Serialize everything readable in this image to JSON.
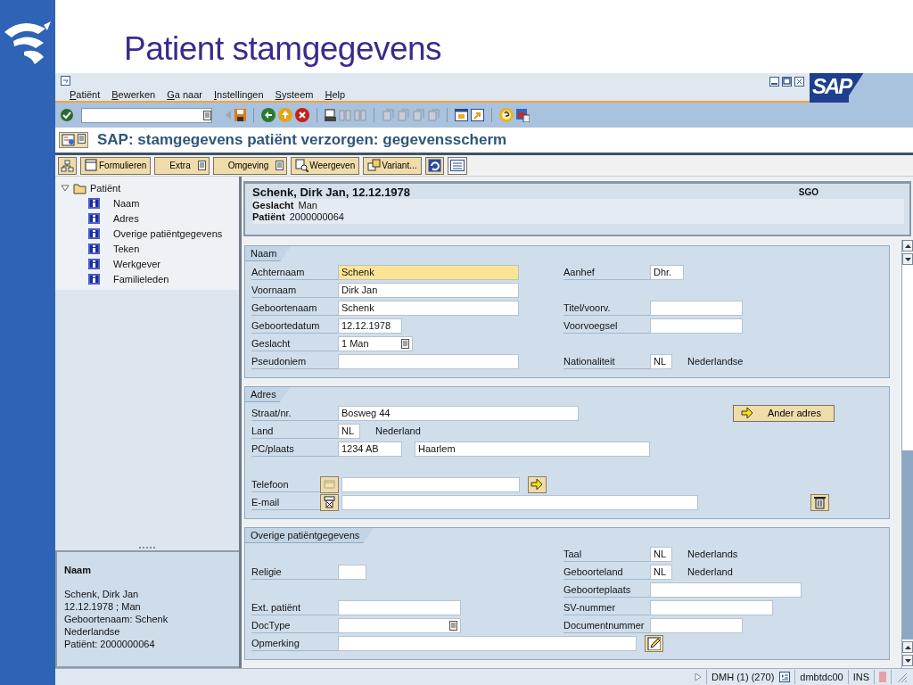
{
  "slide": {
    "title": "Patient stamgegevens"
  },
  "window": {
    "logo": "SAP"
  },
  "menu": [
    {
      "label": "Patiënt"
    },
    {
      "label": "Bewerken"
    },
    {
      "label": "Ga naar"
    },
    {
      "label": "Instellingen"
    },
    {
      "label": "Systeem"
    },
    {
      "label": "Help"
    }
  ],
  "screen_title": "SAP: stamgegevens patiënt verzorgen: gegevensscherm",
  "app_toolbar": [
    {
      "label": "Formulieren",
      "kind": "icon-text"
    },
    {
      "label": "Extra",
      "kind": "menu"
    },
    {
      "label": "Omgeving",
      "kind": "menu"
    },
    {
      "label": "Weergeven",
      "kind": "icon-text"
    },
    {
      "label": "Variant...",
      "kind": "icon-text"
    }
  ],
  "tree": {
    "label": "Patiënt",
    "expanded": true,
    "children": [
      {
        "label": "Naam"
      },
      {
        "label": "Adres"
      },
      {
        "label": "Overige patiëntgegevens"
      },
      {
        "label": "Teken"
      },
      {
        "label": "Werkgever"
      },
      {
        "label": "Familieleden"
      }
    ]
  },
  "info_panel": {
    "title": "Naam",
    "lines": [
      "Schenk, Dirk Jan",
      "12.12.1978 ; Man",
      "Geboortenaam: Schenk",
      "Nederlandse",
      "Patiënt: 2000000064"
    ]
  },
  "header": {
    "title": "Schenk, Dirk Jan, 12.12.1978",
    "code": "SGO",
    "facts": [
      {
        "label": "Geslacht",
        "value": "Man"
      },
      {
        "label": "Patiënt",
        "value": "2000000064"
      }
    ]
  },
  "groups": [
    {
      "title": "Naam",
      "rows": [
        {
          "left": {
            "label": "Achternaam",
            "parts": [
              {
                "kind": "field",
                "value": "Schenk",
                "focused": true
              }
            ]
          },
          "right": {
            "label": "Aanhef",
            "parts": [
              {
                "kind": "field",
                "value": "Dhr."
              }
            ]
          }
        },
        {
          "left": {
            "label": "Voornaam",
            "parts": [
              {
                "kind": "field",
                "value": "Dirk Jan"
              }
            ]
          }
        },
        {
          "left": {
            "label": "Geboortenaam",
            "parts": [
              {
                "kind": "field",
                "value": "Schenk"
              }
            ]
          },
          "right": {
            "label": "Titel/voorv.",
            "parts": [
              {
                "kind": "field"
              }
            ]
          }
        },
        {
          "left": {
            "label": "Geboortedatum",
            "parts": [
              {
                "kind": "field",
                "value": "12.12.1978"
              }
            ]
          },
          "right": {
            "label": "Voorvoegsel",
            "parts": [
              {
                "kind": "field"
              }
            ]
          }
        },
        {
          "left": {
            "label": "Geslacht",
            "parts": [
              {
                "kind": "field",
                "value": "1 Man",
                "dropdown": true
              }
            ]
          }
        },
        {
          "left": {
            "label": "Pseudoniem",
            "parts": [
              {
                "kind": "field"
              }
            ]
          },
          "right": {
            "label": "Nationaliteit",
            "parts": [
              {
                "kind": "field",
                "value": "NL"
              },
              {
                "kind": "text",
                "value": "Nederlandse"
              }
            ]
          }
        }
      ]
    },
    {
      "title": "Adres",
      "rows": [
        {
          "left": {
            "label": "Straat/nr.",
            "parts": [
              {
                "kind": "field",
                "value": "Bosweg 44"
              }
            ]
          },
          "right": {
            "parts": [
              {
                "kind": "button",
                "value": "Ander adres"
              }
            ]
          }
        },
        {
          "left": {
            "label": "Land",
            "parts": [
              {
                "kind": "field",
                "value": "NL"
              },
              {
                "kind": "text",
                "value": "Nederland"
              }
            ]
          }
        },
        {
          "left": {
            "label": "PC/plaats",
            "parts": [
              {
                "kind": "field",
                "value": "1234 AB"
              },
              {
                "kind": "field",
                "value": "Haarlem"
              }
            ]
          }
        },
        {},
        {
          "left": {
            "label": "Telefoon",
            "parts": [
              {
                "kind": "phone-button"
              },
              {
                "kind": "field"
              },
              {
                "kind": "go-button"
              }
            ]
          }
        },
        {
          "left": {
            "label": "E-mail",
            "parts": [
              {
                "kind": "mail-button"
              },
              {
                "kind": "field"
              }
            ]
          },
          "right": {
            "parts": [
              {
                "kind": "delete-button"
              }
            ]
          }
        }
      ]
    },
    {
      "title": "Overige patiëntgegevens",
      "rows": [
        {
          "right": {
            "label": "Taal",
            "parts": [
              {
                "kind": "field",
                "value": "NL"
              },
              {
                "kind": "text",
                "value": "Nederlands"
              }
            ]
          }
        },
        {
          "left": {
            "label": "Religie",
            "parts": [
              {
                "kind": "field"
              }
            ]
          },
          "right": {
            "label": "Geboorteland",
            "parts": [
              {
                "kind": "field",
                "value": "NL"
              },
              {
                "kind": "text",
                "value": "Nederland"
              }
            ]
          }
        },
        {
          "right": {
            "label": "Geboorteplaats",
            "parts": [
              {
                "kind": "field"
              }
            ]
          }
        },
        {
          "left": {
            "label": "Ext. patiënt",
            "parts": [
              {
                "kind": "field"
              }
            ]
          },
          "right": {
            "label": "SV-nummer",
            "parts": [
              {
                "kind": "field"
              }
            ]
          }
        },
        {
          "left": {
            "label": "DocType",
            "parts": [
              {
                "kind": "field",
                "dropdown": true
              }
            ]
          },
          "right": {
            "label": "Documentnummer",
            "parts": [
              {
                "kind": "field"
              }
            ]
          }
        },
        {
          "left": {
            "label": "Opmerking",
            "parts": [
              {
                "kind": "field"
              },
              {
                "kind": "edit-button"
              }
            ]
          }
        }
      ]
    }
  ],
  "status_bar": {
    "system": "DMH (1) (270)",
    "server": "dmbtdc00",
    "mode": "INS"
  }
}
